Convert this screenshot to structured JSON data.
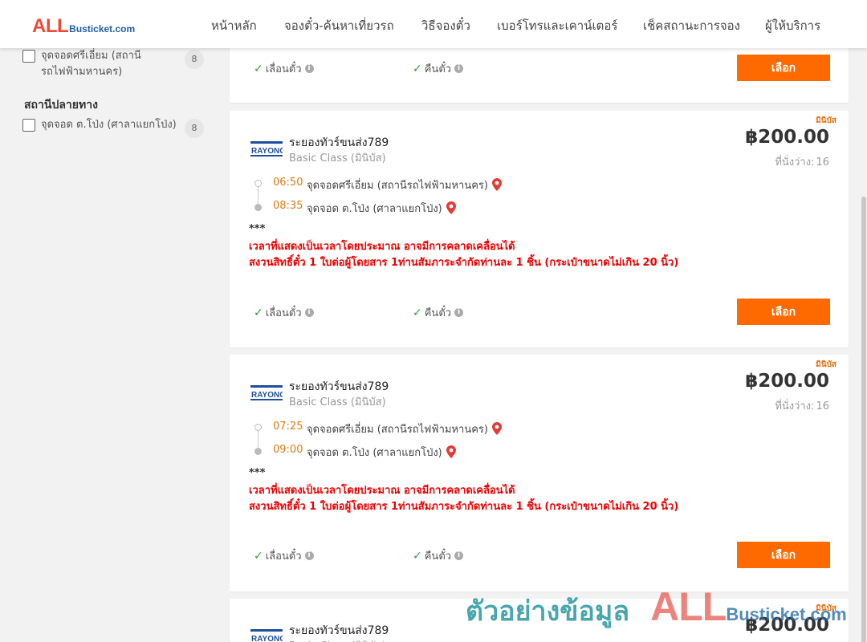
{
  "brand": {
    "logo_all": "ALL",
    "logo_rest": "Busticket.com",
    "accent_color": "#ff6a00",
    "logo_red": "#ec4a35",
    "logo_blue": "#1f5fa8"
  },
  "nav": {
    "items": [
      "หน้าหลัก",
      "จองตั๋ว-ค้นหาเที่ยวรถ",
      "วิธีจองตั๋ว",
      "เบอร์โทรและเคาน์เตอร์",
      "เช็คสถานะการจอง",
      "ผู้ให้บริการ"
    ]
  },
  "sidebar": {
    "origin_partial": {
      "label": "จุดจอดศรีเอี่ยม (สถานีรถไฟฟ้ามหานคร)",
      "count": "8"
    },
    "destination_title": "สถานีปลายทาง",
    "destination": {
      "label": "จุดจอด ต.โป่ง (ศาลาแยกโป่ง)",
      "count": "8"
    }
  },
  "partial_card": {
    "features": [
      "เลื่อนตั๋ว",
      "คืนตั๋ว"
    ],
    "select_label": "เลือก"
  },
  "trips": [
    {
      "bus_type": "มินิบัส",
      "operator": "ระยองทัวร์ขนส่ง789",
      "bus_class": "Basic Class (มินิบัส)",
      "price": "฿200.00",
      "seats_label": "ที่นั่งว่าง:",
      "seats_count": "16",
      "depart_time": "06:50",
      "depart_stop": "จุดจอดศรีเอี่ยม (สถานีรถไฟฟ้ามหานคร)",
      "arrive_time": "08:35",
      "arrive_stop": "จุดจอด ต.โป่ง (ศาลาแยกโป่ง)",
      "stars": "***",
      "notice_1": "เวลาที่แสดงเป็นเวลาโดยประมาณ อาจมีการคลาดเคลื่อนได้",
      "notice_2": "สงวนสิทธิ์ตั๋ว 1 ใบต่อผู้โดยสาร 1ท่านสัมภาระจำกัดท่านละ 1 ชิ้น (กระเป๋าขนาดไม่เกิน 20 นิ้ว)",
      "features": [
        "เลื่อนตั๋ว",
        "คืนตั๋ว"
      ],
      "select_label": "เลือก"
    },
    {
      "bus_type": "มินิบัส",
      "operator": "ระยองทัวร์ขนส่ง789",
      "bus_class": "Basic Class (มินิบัส)",
      "price": "฿200.00",
      "seats_label": "ที่นั่งว่าง:",
      "seats_count": "16",
      "depart_time": "07:25",
      "depart_stop": "จุดจอดศรีเอี่ยม (สถานีรถไฟฟ้ามหานคร)",
      "arrive_time": "09:00",
      "arrive_stop": "จุดจอด ต.โป่ง (ศาลาแยกโป่ง)",
      "stars": "***",
      "notice_1": "เวลาที่แสดงเป็นเวลาโดยประมาณ อาจมีการคลาดเคลื่อนได้",
      "notice_2": "สงวนสิทธิ์ตั๋ว 1 ใบต่อผู้โดยสาร 1ท่านสัมภาระจำกัดท่านละ 1 ชิ้น (กระเป๋าขนาดไม่เกิน 20 นิ้ว)",
      "features": [
        "เลื่อนตั๋ว",
        "คืนตั๋ว"
      ],
      "select_label": "เลือก"
    },
    {
      "bus_type": "มินิบัส",
      "operator": "ระยองทัวร์ขนส่ง789",
      "bus_class": "Basic Class (มินิบัส)",
      "price": "฿200.00"
    }
  ],
  "operator_logo_text": "RAYONG",
  "watermark": {
    "thai": "ตัวอย่างข้อมูล",
    "all": "ALL",
    "rest": "Busticket.com"
  }
}
